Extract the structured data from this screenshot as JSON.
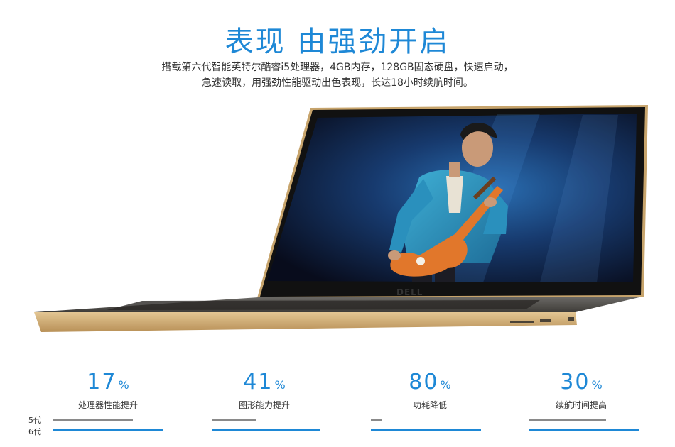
{
  "header": {
    "title": "表现 由强劲开启",
    "subtitle_line1": "搭载第六代智能英特尔酷睿i5处理器，4GB内存，128GB固态硬盘，快速启动，",
    "subtitle_line2": "急速读取，用强劲性能驱动出色表现，长达18小时续航时间。"
  },
  "laptop": {
    "brand": "DELL"
  },
  "stats": [
    {
      "value": "17",
      "unit": "%",
      "label": "处理器性能提升"
    },
    {
      "value": "41",
      "unit": "%",
      "label": "图形能力提升"
    },
    {
      "value": "80",
      "unit": "%",
      "label": "功耗降低"
    },
    {
      "value": "30",
      "unit": "%",
      "label": "续航时间提高"
    }
  ],
  "generations": {
    "old": "5代",
    "new": "6代"
  },
  "colors": {
    "accent": "#1e88d6",
    "bar_old": "#8a8a8a"
  }
}
